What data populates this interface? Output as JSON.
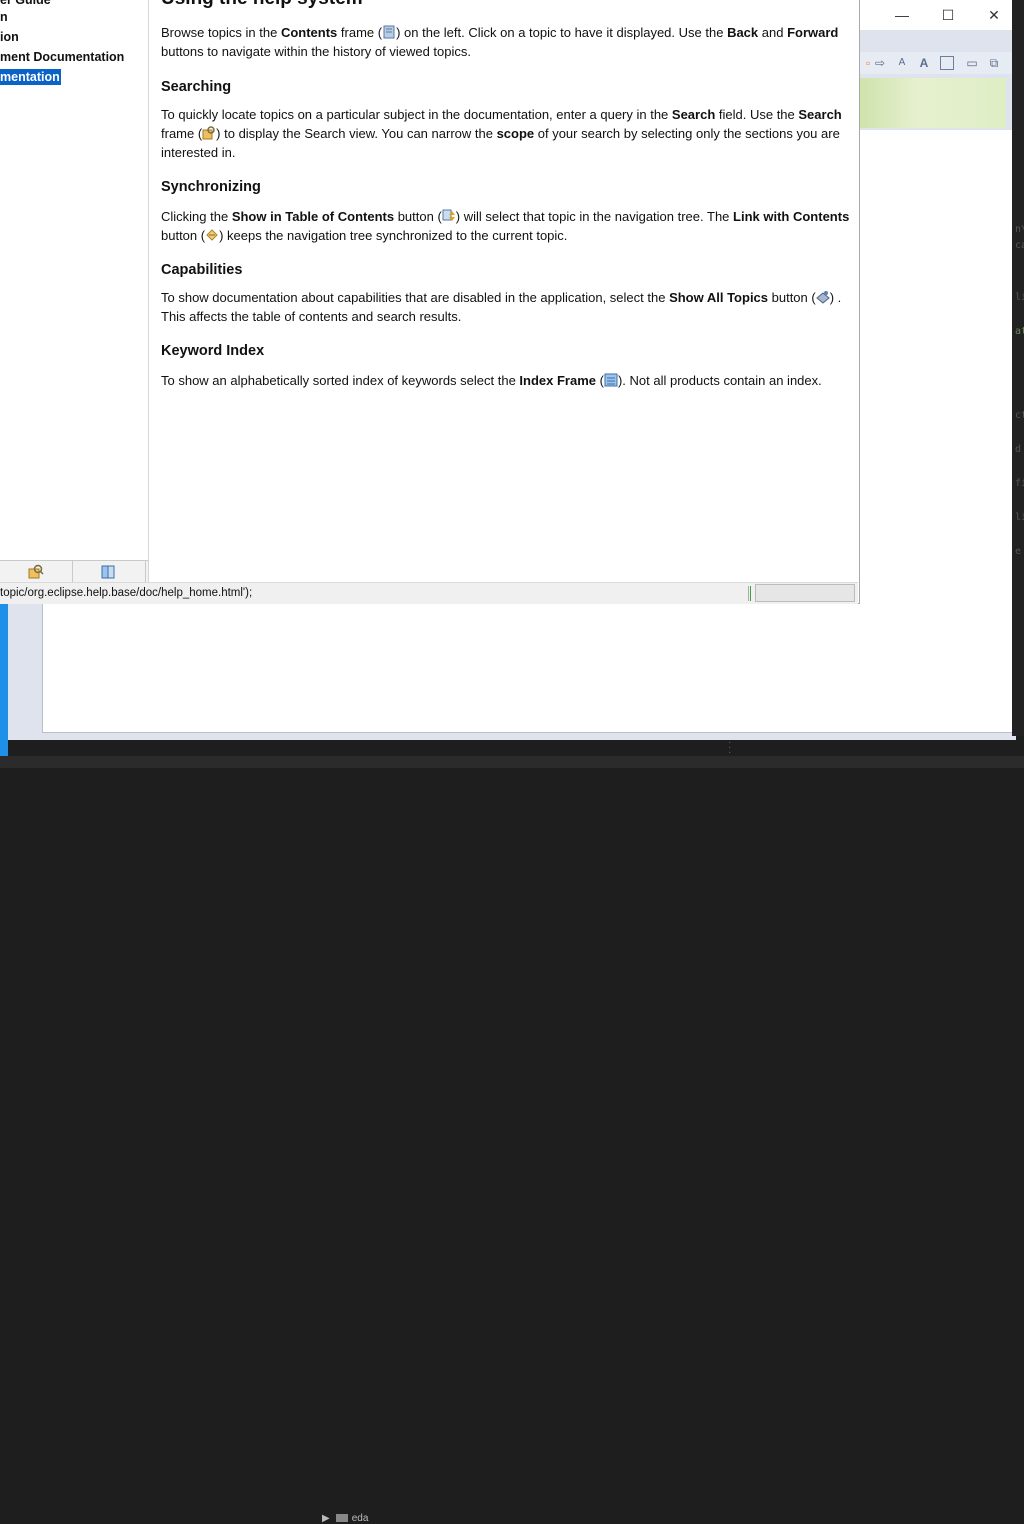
{
  "help_window": {
    "toc": {
      "items": [
        {
          "label": "er Guide",
          "selected": false
        },
        {
          "label": "n",
          "selected": false
        },
        {
          "label": "ion",
          "selected": false
        },
        {
          "label": "ment Documentation",
          "selected": false
        },
        {
          "label": "mentation",
          "selected": true
        }
      ],
      "tabs": [
        {
          "icon": "search-icon"
        },
        {
          "icon": "index-icon"
        }
      ]
    },
    "content": {
      "title": "Using the help system",
      "sections": {
        "intro": {
          "t1": "Browse topics in the ",
          "b1": "Contents",
          "t2": " frame (",
          "t3": ") on the left. Click on a topic to have it displayed. Use the ",
          "b2": "Back",
          "t4": " and ",
          "b3": "Forward",
          "t5": " buttons to navigate within the history of viewed topics."
        },
        "searching": {
          "heading": "Searching",
          "t1": "To quickly locate topics on a particular subject in the documentation, enter a query in the ",
          "b1": "Search",
          "t2": " field. Use the ",
          "b2": "Search",
          "t3": " frame (",
          "t4": ") to display the Search view. You can narrow the ",
          "b3": "scope",
          "t5": " of your search by selecting only the sections you are interested in."
        },
        "synchronizing": {
          "heading": "Synchronizing",
          "t1": "Clicking the ",
          "b1": "Show in Table of Contents",
          "t2": " button (",
          "t3": ") will select that topic in the navigation tree. The ",
          "b2": "Link with Contents",
          "t4": " button (",
          "t5": ") keeps the navigation tree synchronized to the current topic."
        },
        "capabilities": {
          "heading": "Capabilities",
          "t1": "To show documentation about capabilities that are disabled in the application, select the ",
          "b1": "Show All Topics",
          "t2": " button (",
          "t3": ") . This affects the table of contents and search results."
        },
        "keyword_index": {
          "heading": "Keyword Index",
          "t1": "To show an alphabetically sorted index of keywords select the ",
          "b1": "Index Frame",
          "t2": " (",
          "t3": "). Not all products contain an index."
        }
      }
    },
    "status_bar": {
      "url": "topic/org.eclipse.help.base/doc/help_home.html');"
    }
  },
  "background_app": {
    "window_controls": {
      "minimize": "—",
      "maximize": "☐",
      "close": "✕"
    },
    "taskbar_item": "eda",
    "editor_fragments": [
      "n\\",
      "ca",
      "li",
      "at",
      "ct",
      "d",
      "fi",
      "li",
      "e"
    ]
  },
  "colors": {
    "selection": "#0a64c8",
    "desktop_accent": "#1e90e8",
    "window_bg": "#dfe3ee"
  }
}
